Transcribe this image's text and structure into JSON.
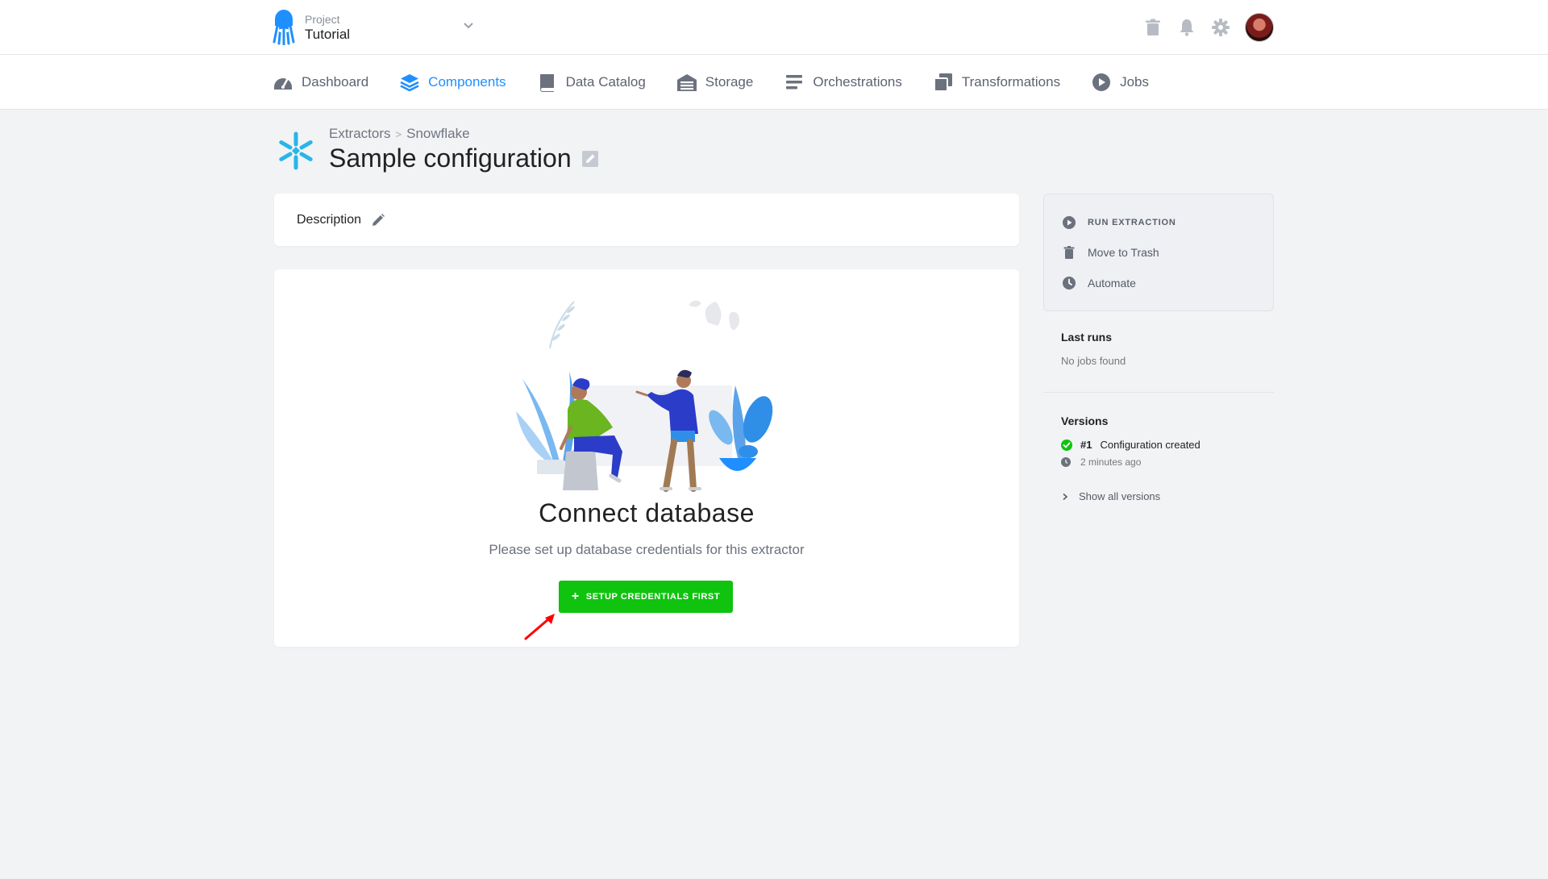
{
  "topbar": {
    "project_label": "Project",
    "project_name": "Tutorial",
    "icons": [
      "trash-icon",
      "bell-icon",
      "gear-icon"
    ]
  },
  "nav": {
    "items": [
      {
        "label": "Dashboard",
        "icon": "dashboard-icon",
        "active": false
      },
      {
        "label": "Components",
        "icon": "layers-icon",
        "active": true
      },
      {
        "label": "Data Catalog",
        "icon": "book-icon",
        "active": false
      },
      {
        "label": "Storage",
        "icon": "storage-icon",
        "active": false
      },
      {
        "label": "Orchestrations",
        "icon": "orchestration-icon",
        "active": false
      },
      {
        "label": "Transformations",
        "icon": "transformation-icon",
        "active": false
      },
      {
        "label": "Jobs",
        "icon": "play-icon",
        "active": false
      }
    ]
  },
  "header": {
    "breadcrumb_1": "Extractors",
    "breadcrumb_2": "Snowflake",
    "title": "Sample configuration"
  },
  "description": {
    "label": "Description"
  },
  "main": {
    "title": "Connect database",
    "subtitle": "Please set up database credentials for this extractor",
    "button_label": "SETUP CREDENTIALS FIRST"
  },
  "sidebar": {
    "run_label": "RUN EXTRACTION",
    "trash_label": "Move to Trash",
    "automate_label": "Automate",
    "last_runs_title": "Last runs",
    "last_runs_empty": "No jobs found",
    "versions_title": "Versions",
    "version_number": "#1",
    "version_desc": "Configuration created",
    "version_time": "2 minutes ago",
    "show_all_label": "Show all versions"
  },
  "colors": {
    "accent": "#1f8fff",
    "success": "#0fc30f",
    "annotation_arrow": "#ff0000"
  }
}
